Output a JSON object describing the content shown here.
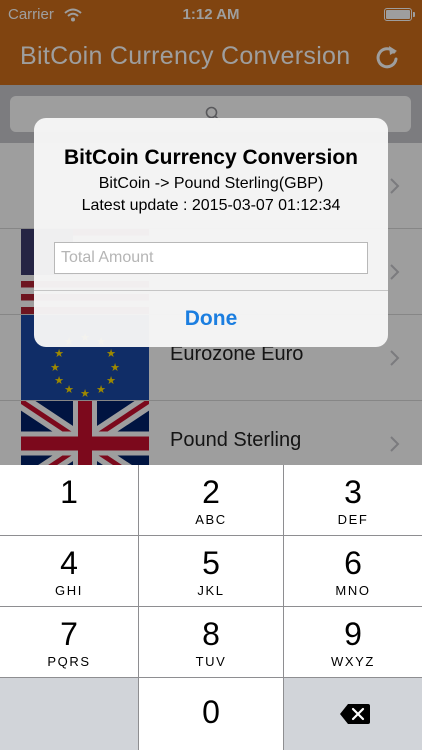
{
  "status_bar": {
    "carrier": "Carrier",
    "time": "1:12 AM"
  },
  "nav": {
    "title": "BitCoin Currency Conversion",
    "refresh_icon": "refresh-icon"
  },
  "search": {
    "icon": "search-icon"
  },
  "list": {
    "items": [
      {
        "label": "",
        "flag": "none"
      },
      {
        "label": "",
        "flag": "us-flag-icon"
      },
      {
        "label": "Eurozone Euro",
        "flag": "eu-flag-icon"
      },
      {
        "label": "Pound Sterling",
        "flag": "uk-flag-icon"
      }
    ]
  },
  "alert": {
    "title": "BitCoin Currency Conversion",
    "line1": "BitCoin -> Pound Sterling(GBP)",
    "line2": "Latest update : 2015-03-07 01:12:34",
    "input_placeholder": "Total Amount",
    "input_value": "",
    "done_label": "Done"
  },
  "keypad": {
    "keys": [
      {
        "num": "1",
        "letters": ""
      },
      {
        "num": "2",
        "letters": "ABC"
      },
      {
        "num": "3",
        "letters": "DEF"
      },
      {
        "num": "4",
        "letters": "GHI"
      },
      {
        "num": "5",
        "letters": "JKL"
      },
      {
        "num": "6",
        "letters": "MNO"
      },
      {
        "num": "7",
        "letters": "PQRS"
      },
      {
        "num": "8",
        "letters": "TUV"
      },
      {
        "num": "9",
        "letters": "WXYZ"
      },
      {
        "num": "0",
        "letters": ""
      }
    ],
    "delete_icon": "backspace-icon"
  },
  "colors": {
    "brand": "#cf6e1a",
    "done_blue": "#1b7ee0",
    "keypad_bg": "#8e8e91",
    "key_white": "#ffffff",
    "key_gray": "#d1d4d9"
  }
}
